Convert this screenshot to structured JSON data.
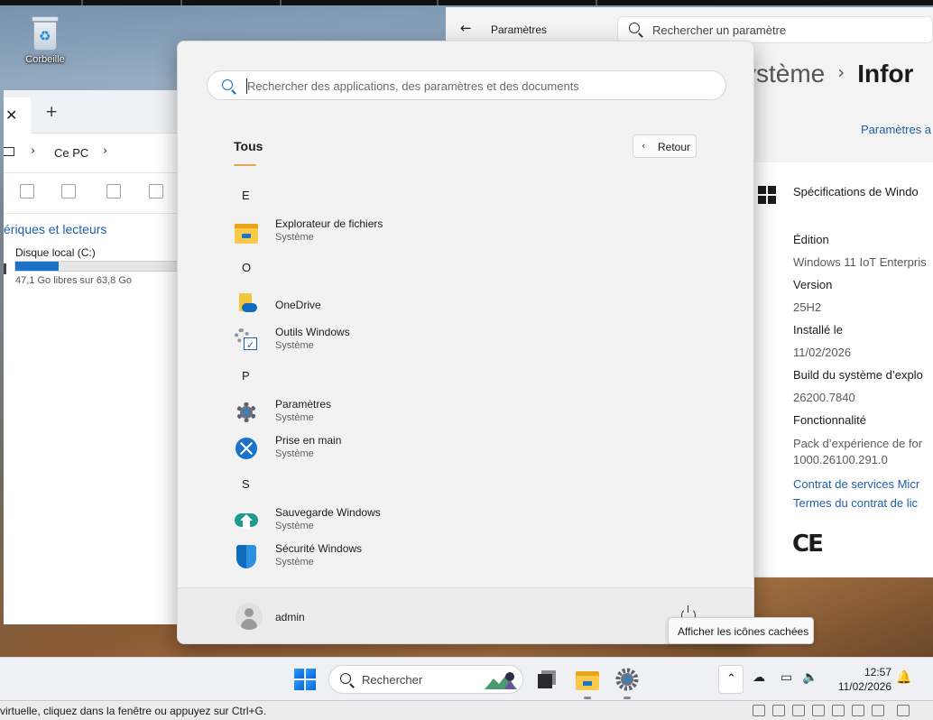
{
  "desktop": {
    "recycle_bin_label": "Corbeille"
  },
  "explorer": {
    "breadcrumb": "Ce PC",
    "section_title": "ériques et lecteurs",
    "drive": {
      "name": "Disque local (C:)",
      "free_text": "47,1 Go libres sur 63,8 Go",
      "used_fraction": 0.262
    }
  },
  "settings": {
    "app_title": "Paramètres",
    "search_placeholder": "Rechercher un paramètre",
    "heading_parent": "ystème",
    "heading_current": "Infor",
    "rename_link": "Paramètres a",
    "spec_title": "Spécifications de Windo",
    "fields": [
      {
        "label": "Édition",
        "value": "Windows 11 IoT Enterpris"
      },
      {
        "label": "Version",
        "value": "25H2"
      },
      {
        "label": "Installé le",
        "value": "11/02/2026"
      },
      {
        "label": "Build du système d’explo",
        "value": "26200.7840"
      },
      {
        "label": "Fonctionnalité",
        "value": "Pack d’expérience de for",
        "value2": "1000.26100.291.0"
      }
    ],
    "links": [
      "Contrat de services Micr",
      "Termes du contrat de lic"
    ],
    "ce_mark": "CE"
  },
  "start_menu": {
    "search_placeholder": "Rechercher des applications, des paramètres et des documents",
    "all_label": "Tous",
    "back_label": "Retour",
    "groups": [
      {
        "letter": "E",
        "apps": [
          {
            "name": "Explorateur de fichiers",
            "sub": "Système",
            "icon": "file-explorer-icon"
          }
        ]
      },
      {
        "letter": "O",
        "apps": [
          {
            "name": "OneDrive",
            "sub": "",
            "icon": "onedrive-icon"
          },
          {
            "name": "Outils Windows",
            "sub": "Système",
            "icon": "windows-tools-icon"
          }
        ]
      },
      {
        "letter": "P",
        "apps": [
          {
            "name": "Paramètres",
            "sub": "Système",
            "icon": "settings-gear-icon"
          },
          {
            "name": "Prise en main",
            "sub": "Système",
            "icon": "get-started-icon"
          }
        ]
      },
      {
        "letter": "S",
        "apps": [
          {
            "name": "Sauvegarde Windows",
            "sub": "Système",
            "icon": "backup-icon"
          },
          {
            "name": "Sécurité Windows",
            "sub": "Système",
            "icon": "shield-icon"
          }
        ]
      }
    ],
    "user_name": "admin"
  },
  "tooltip": "Afficher les icônes cachées",
  "taskbar": {
    "search_label": "Rechercher",
    "time": "12:57",
    "date": "11/02/2026"
  },
  "statusbar": {
    "message": "virtuelle, cliquez dans la fenêtre ou appuyez sur Ctrl+G."
  }
}
